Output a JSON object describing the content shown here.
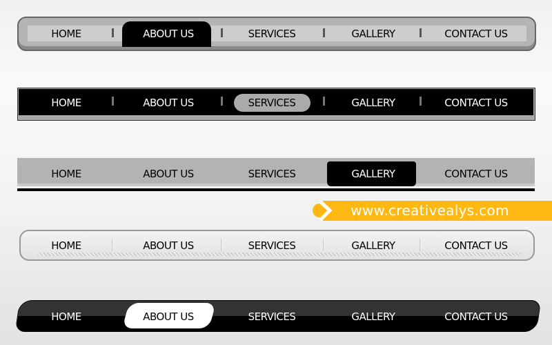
{
  "menu_items": [
    "HOME",
    "ABOUT US",
    "SERVICES",
    "GALLERY",
    "CONTACT US"
  ],
  "navbars": [
    {
      "style": "gray-rounded",
      "active": "ABOUT US"
    },
    {
      "style": "black-box",
      "active": "SERVICES"
    },
    {
      "style": "gray-flat",
      "active": "GALLERY"
    },
    {
      "style": "light-glass",
      "active": null
    },
    {
      "style": "black-skewed",
      "active": "ABOUT US"
    }
  ],
  "banner": {
    "text": "www.creativealys.com",
    "color": "#fdb813"
  },
  "colors": {
    "black": "#000000",
    "gray": "#b3b3b3",
    "light": "#e6e6e6"
  }
}
